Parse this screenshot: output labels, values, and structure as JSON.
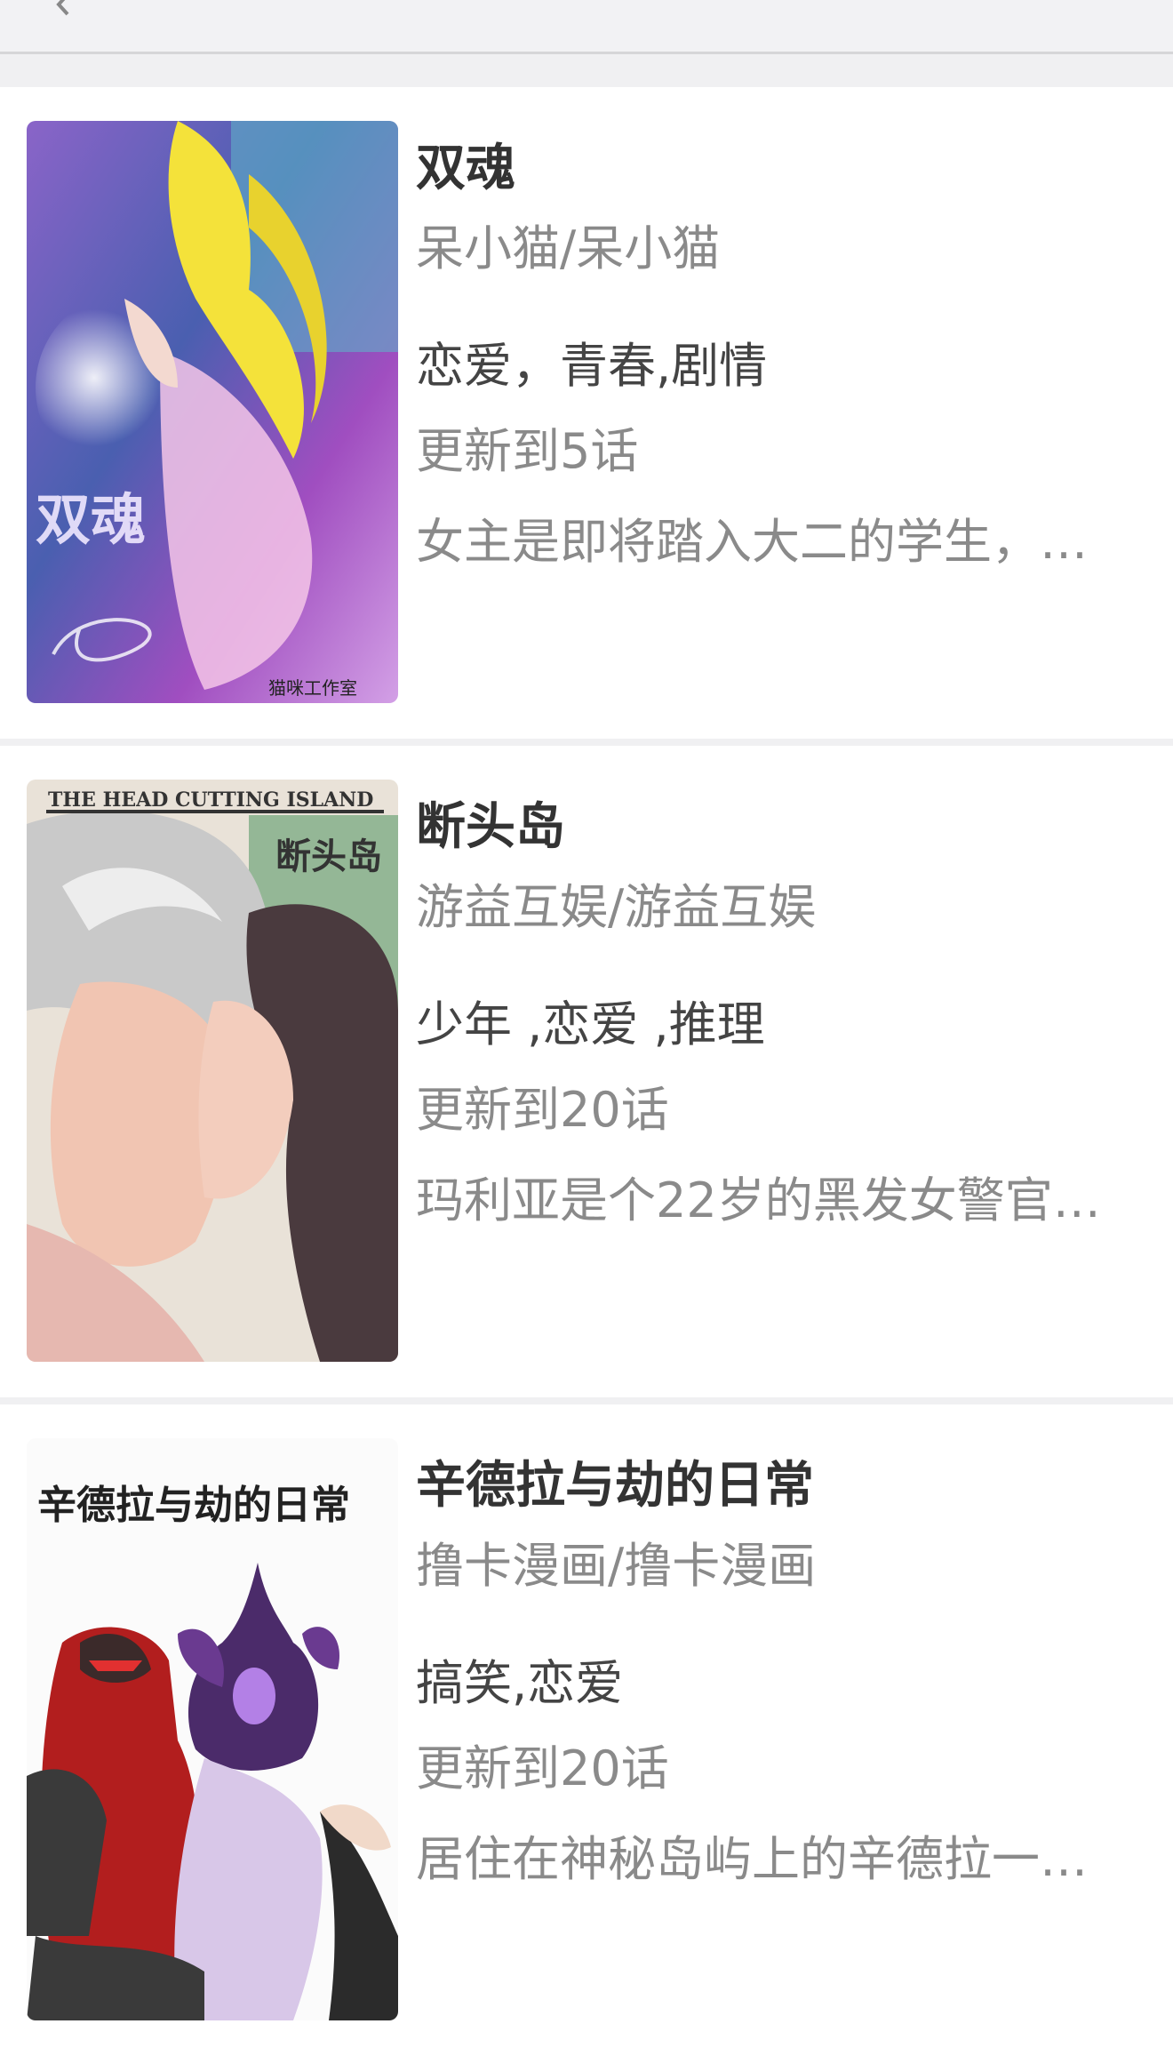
{
  "header": {
    "back_icon": "back-arrow-icon"
  },
  "comics": [
    {
      "title": "双魂",
      "author": "呆小猫/呆小猫",
      "tags": "恋爱，青春,剧情",
      "update": "更新到5话",
      "desc": "女主是即将踏入大二的学生，…",
      "cover_text": "双魂",
      "cover_credit": "猫咪工作室"
    },
    {
      "title": "断头岛",
      "author": "游益互娱/游益互娱",
      "tags": "少年 ,恋爱 ,推理",
      "update": "更新到20话",
      "desc": "玛利亚是个22岁的黑发女警官…",
      "cover_text": "THE HEAD CUTTING ISLAND",
      "cover_sub": "断头岛"
    },
    {
      "title": "辛德拉与劫的日常",
      "author": "撸卡漫画/撸卡漫画",
      "tags": "搞笑,恋爱",
      "update": "更新到20话",
      "desc": "居住在神秘岛屿上的辛德拉一…",
      "cover_text": "辛德拉与劫的日常"
    }
  ]
}
